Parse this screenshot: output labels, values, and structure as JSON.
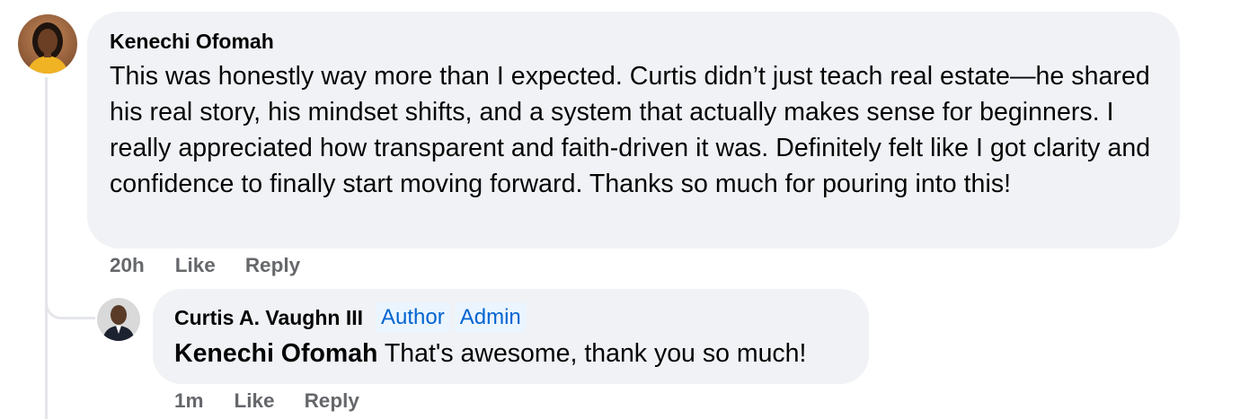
{
  "comment": {
    "author": "Kenechi Ofomah",
    "avatar_icon": "profile-photo-woman",
    "text": "This was honestly way more than I expected. Curtis didn’t just teach real estate—he shared his real story, his mindset shifts, and a system that actually makes sense for beginners. I really appreciated how transparent and faith-driven it was. Definitely felt like I got clarity and confidence to finally start moving forward. Thanks so much for pouring into this!",
    "time": "20h",
    "like_label": "Like",
    "reply_label": "Reply"
  },
  "reply": {
    "author": "Curtis A. Vaughn III",
    "avatar_icon": "profile-photo-man",
    "badges": [
      "Author",
      "Admin"
    ],
    "mention": "Kenechi Ofomah",
    "text": " That's awesome, thank you so much!",
    "time": "1m",
    "like_label": "Like",
    "reply_label": "Reply"
  },
  "colors": {
    "bubble_bg": "#f0f2f5",
    "badge_bg": "#ebf5ff",
    "badge_text": "#0064d1",
    "meta_text": "#65676b",
    "thread_line": "#e4e6eb"
  }
}
